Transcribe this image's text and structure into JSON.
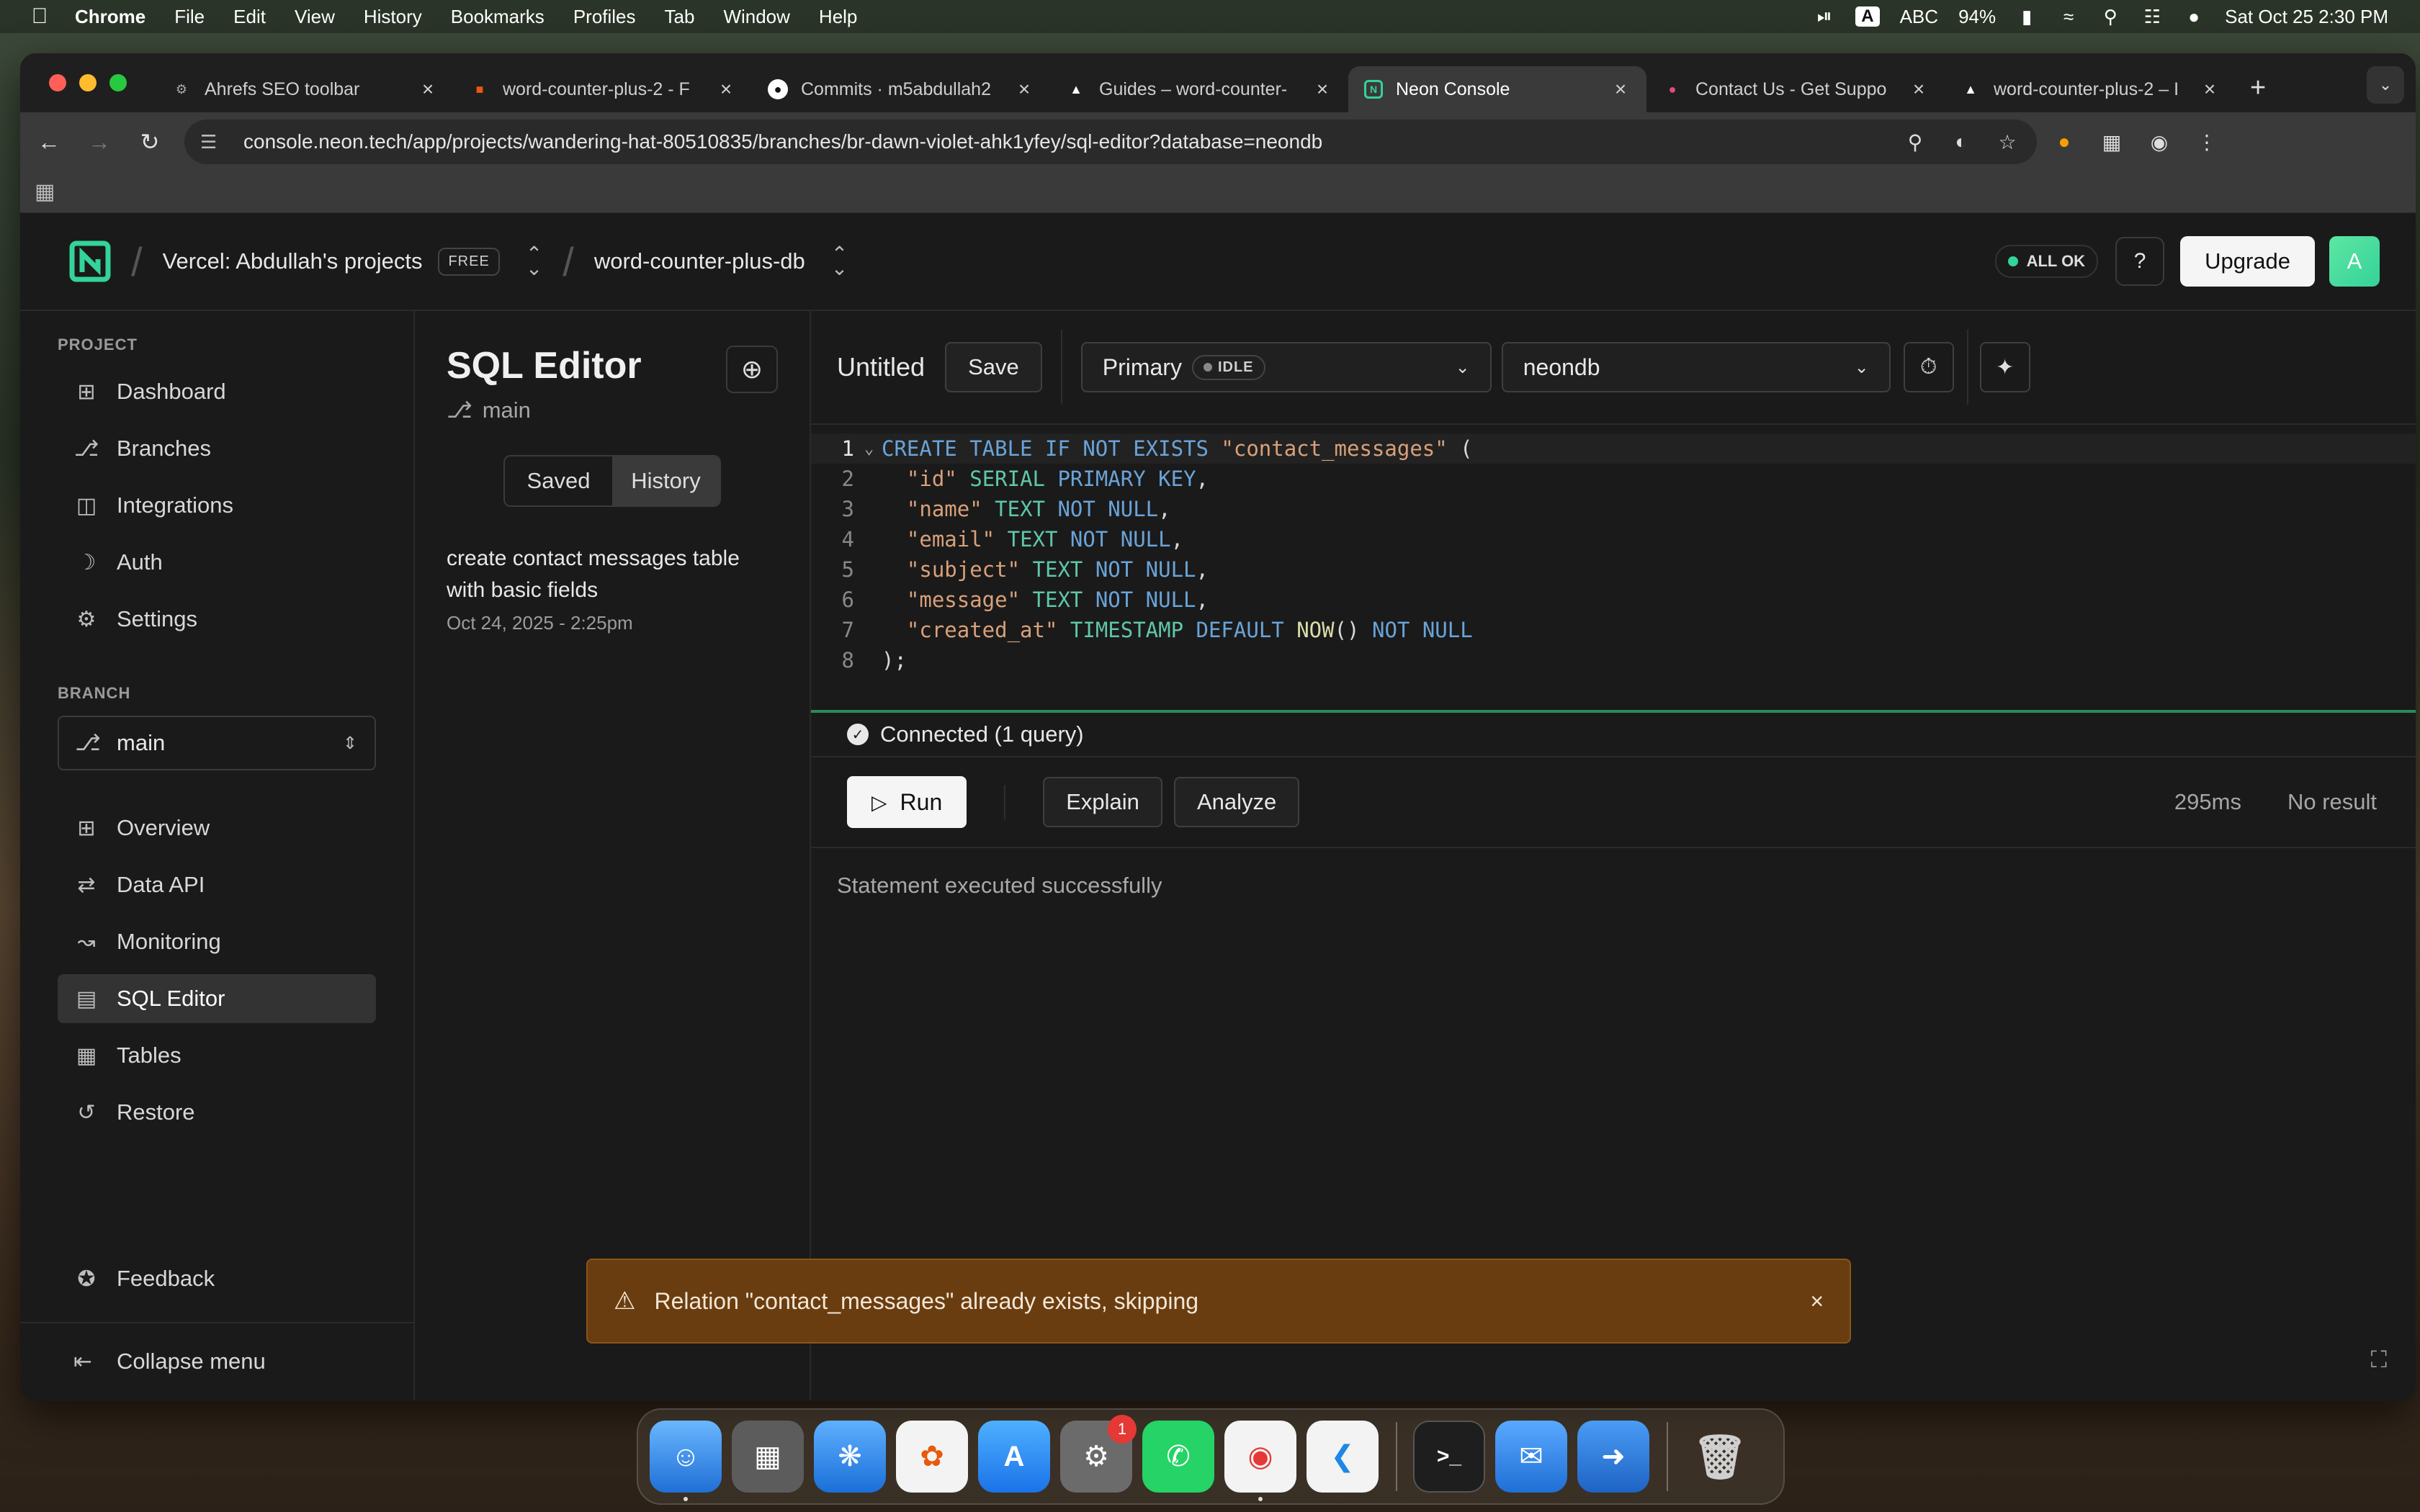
{
  "menubar": {
    "app": "Chrome",
    "items": [
      "File",
      "Edit",
      "View",
      "History",
      "Bookmarks",
      "Profiles",
      "Tab",
      "Window",
      "Help"
    ],
    "input_source": "A",
    "input_label": "ABC",
    "battery": "94%",
    "datetime": "Sat Oct 25  2:30 PM"
  },
  "browser": {
    "tabs": [
      {
        "label": "Ahrefs SEO toolbar",
        "favicon_color": "#888888"
      },
      {
        "label": "word-counter-plus-2 - F",
        "favicon_color": "#e8590c"
      },
      {
        "label": "Commits · m5abdullah2",
        "favicon_color": "#ffffff"
      },
      {
        "label": "Guides – word-counter-",
        "favicon_color": "#ffffff"
      },
      {
        "label": "Neon Console",
        "favicon_color": "#34d399",
        "active": true
      },
      {
        "label": "Contact Us - Get Suppo",
        "favicon_color": "#e64980"
      },
      {
        "label": "word-counter-plus-2 – I",
        "favicon_color": "#ffffff"
      }
    ],
    "url": "console.neon.tech/app/projects/wandering-hat-80510835/branches/br-dawn-violet-ahk1yfey/sql-editor?database=neondb"
  },
  "header": {
    "org": "Vercel: Abdullah's projects",
    "plan_badge": "FREE",
    "project": "word-counter-plus-db",
    "status": "ALL OK",
    "status_color": "#34d399",
    "help_label": "?",
    "upgrade_label": "Upgrade",
    "avatar_initial": "A"
  },
  "sidebar": {
    "project_label": "PROJECT",
    "project_items": [
      {
        "label": "Dashboard",
        "icon": "dashboard-icon"
      },
      {
        "label": "Branches",
        "icon": "branches-icon"
      },
      {
        "label": "Integrations",
        "icon": "integrations-icon"
      },
      {
        "label": "Auth",
        "icon": "auth-icon"
      },
      {
        "label": "Settings",
        "icon": "gear-icon"
      }
    ],
    "branch_label": "BRANCH",
    "branch_value": "main",
    "branch_items": [
      {
        "label": "Overview",
        "icon": "overview-icon"
      },
      {
        "label": "Data API",
        "icon": "data-api-icon"
      },
      {
        "label": "Monitoring",
        "icon": "monitoring-icon"
      },
      {
        "label": "SQL Editor",
        "icon": "sql-editor-icon",
        "active": true
      },
      {
        "label": "Tables",
        "icon": "tables-icon"
      },
      {
        "label": "Restore",
        "icon": "restore-icon"
      }
    ],
    "feedback": "Feedback",
    "collapse": "Collapse menu"
  },
  "editor_panel": {
    "title": "SQL Editor",
    "branch": "main",
    "tabs": [
      "Saved",
      "History"
    ],
    "active_tab": "History",
    "history": [
      {
        "title": "create contact messages table with basic fields",
        "date": "Oct 24, 2025 - 2:25pm"
      }
    ]
  },
  "editor": {
    "query_name": "Untitled",
    "save_label": "Save",
    "compute": "Primary",
    "compute_state": "IDLE",
    "database": "neondb",
    "code_lines": [
      "CREATE TABLE IF NOT EXISTS \"contact_messages\" (",
      "  \"id\" SERIAL PRIMARY KEY,",
      "  \"name\" TEXT NOT NULL,",
      "  \"email\" TEXT NOT NULL,",
      "  \"subject\" TEXT NOT NULL,",
      "  \"message\" TEXT NOT NULL,",
      "  \"created_at\" TIMESTAMP DEFAULT NOW() NOT NULL",
      ");"
    ],
    "connection": "Connected (1 query)",
    "run_label": "Run",
    "explain_label": "Explain",
    "analyze_label": "Analyze",
    "duration": "295ms",
    "result_summary": "No result",
    "result_message": "Statement executed successfully"
  },
  "toast": {
    "message": "Relation \"contact_messages\" already exists, skipping",
    "bg_color": "#6a3d10"
  },
  "dock": {
    "apps": [
      {
        "icon": "finder-icon",
        "color": "#3a8ee6"
      },
      {
        "icon": "launchpad-icon",
        "color": "#6b6b6b"
      },
      {
        "icon": "safari-icon",
        "color": "#2f86e0"
      },
      {
        "icon": "photos-icon",
        "color": "#f0f0f0"
      },
      {
        "icon": "app-store-icon",
        "color": "#2a86f0"
      },
      {
        "icon": "system-settings-icon",
        "color": "#7a7a7a",
        "badge": "1"
      },
      {
        "icon": "whatsapp-icon",
        "color": "#25d366"
      },
      {
        "icon": "chrome-icon",
        "color": "#ffffff"
      },
      {
        "icon": "vscode-icon",
        "color": "#1e88e5"
      },
      {
        "icon": "terminal-icon",
        "color": "#222222"
      },
      {
        "icon": "mail-icon",
        "color": "#3d8ef0"
      },
      {
        "icon": "migration-icon",
        "color": "#2e7bd6"
      },
      {
        "icon": "trash-icon",
        "color": "#9a9a9a"
      }
    ]
  }
}
